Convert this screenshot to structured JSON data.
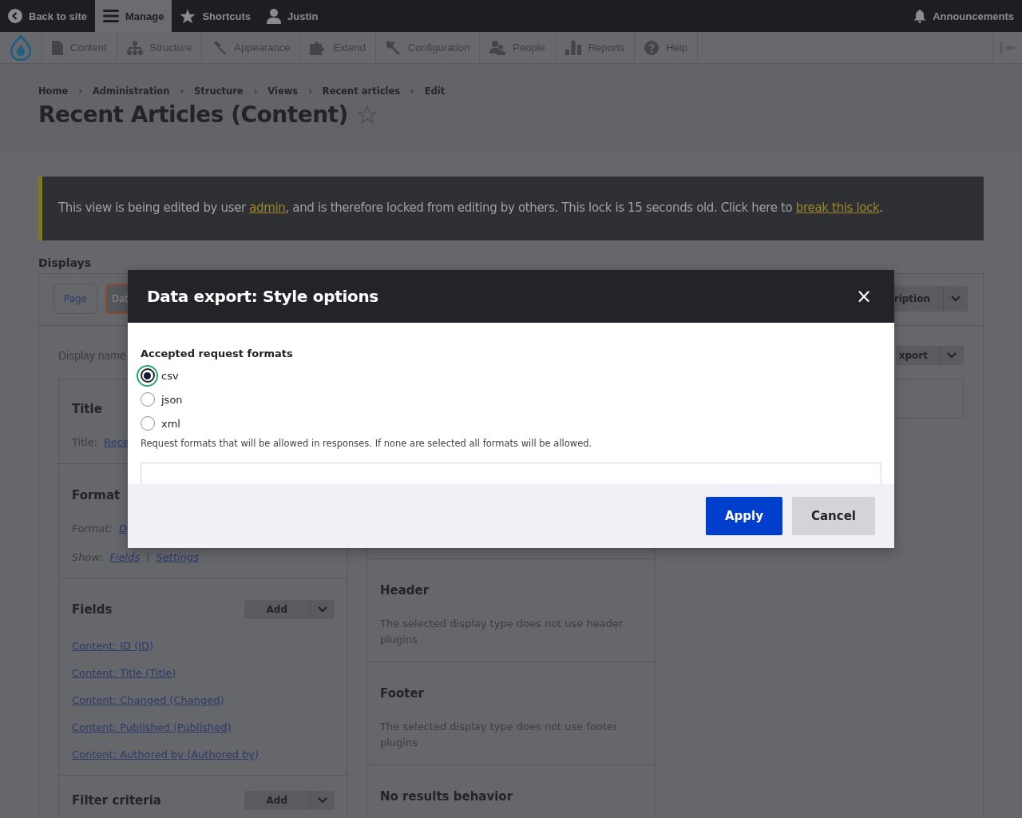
{
  "toolbar": {
    "items": [
      {
        "label": "Back to site",
        "selected": false
      },
      {
        "label": "Manage",
        "selected": true
      },
      {
        "label": "Shortcuts",
        "selected": false
      },
      {
        "label": "Justin",
        "selected": false
      }
    ],
    "announcements": "Announcements"
  },
  "admin_menu": [
    "Content",
    "Structure",
    "Appearance",
    "Extend",
    "Configuration",
    "People",
    "Reports",
    "Help"
  ],
  "breadcrumb": [
    "Home",
    "Administration",
    "Structure",
    "Views",
    "Recent articles",
    "Edit"
  ],
  "breadcrumb_separator": "›",
  "page_title": "Recent Articles (Content)",
  "lock_message": [
    {
      "kind": "text",
      "text": "This view is being edited by user "
    },
    {
      "kind": "link",
      "text": "admin"
    },
    {
      "kind": "text",
      "text": ", and is therefore locked from editing by others. This lock is 15 seconds old. Click here to "
    },
    {
      "kind": "link",
      "text": "break this lock"
    },
    {
      "kind": "text",
      "text": "."
    }
  ],
  "displays": {
    "label": "Displays",
    "tabs": [
      {
        "label": "Page",
        "selected": false
      },
      {
        "label": "Dat",
        "selected": true
      }
    ],
    "right_button": "ription",
    "display_name_label": "Display name",
    "display_button": "xport"
  },
  "left_column": [
    {
      "title": "Title",
      "lines": [
        {
          "kind": "plain",
          "label": "Title:",
          "links": [
            "Rece"
          ]
        }
      ]
    },
    {
      "title": "Format",
      "lines": [
        {
          "kind": "italic",
          "label": "Format:",
          "links": [
            "D"
          ]
        },
        {
          "kind": "italic",
          "label": "Show:",
          "links": [
            "Fields",
            "Settings"
          ],
          "separator": "|"
        }
      ]
    },
    {
      "title": "Fields",
      "add": "Add",
      "links": [
        "Content: ID (ID)",
        "Content: Title (Title)",
        "Content: Changed (Changed)",
        "Content: Published (Published)",
        "Content: Authored by (Authored by)"
      ]
    },
    {
      "title": "Filter criteria",
      "add": "Add"
    }
  ],
  "middle_column": [
    {
      "title": "Header",
      "text": "The selected display type does not use header plugins"
    },
    {
      "title": "Footer",
      "text": "The selected display type does not use footer plugins"
    },
    {
      "title": "No results behavior"
    }
  ],
  "dialog": {
    "title": "Data export: Style options",
    "close": "×",
    "fieldset_label": "Accepted request formats",
    "options": [
      {
        "label": "csv",
        "selected": true
      },
      {
        "label": "json",
        "selected": false
      },
      {
        "label": "xml",
        "selected": false
      }
    ],
    "description": "Request formats that will be allowed in responses. If none are selected all formats will be allowed.",
    "buttons": [
      {
        "label": "Apply",
        "kind": "primary"
      },
      {
        "label": "Cancel",
        "kind": "secondary"
      }
    ]
  }
}
